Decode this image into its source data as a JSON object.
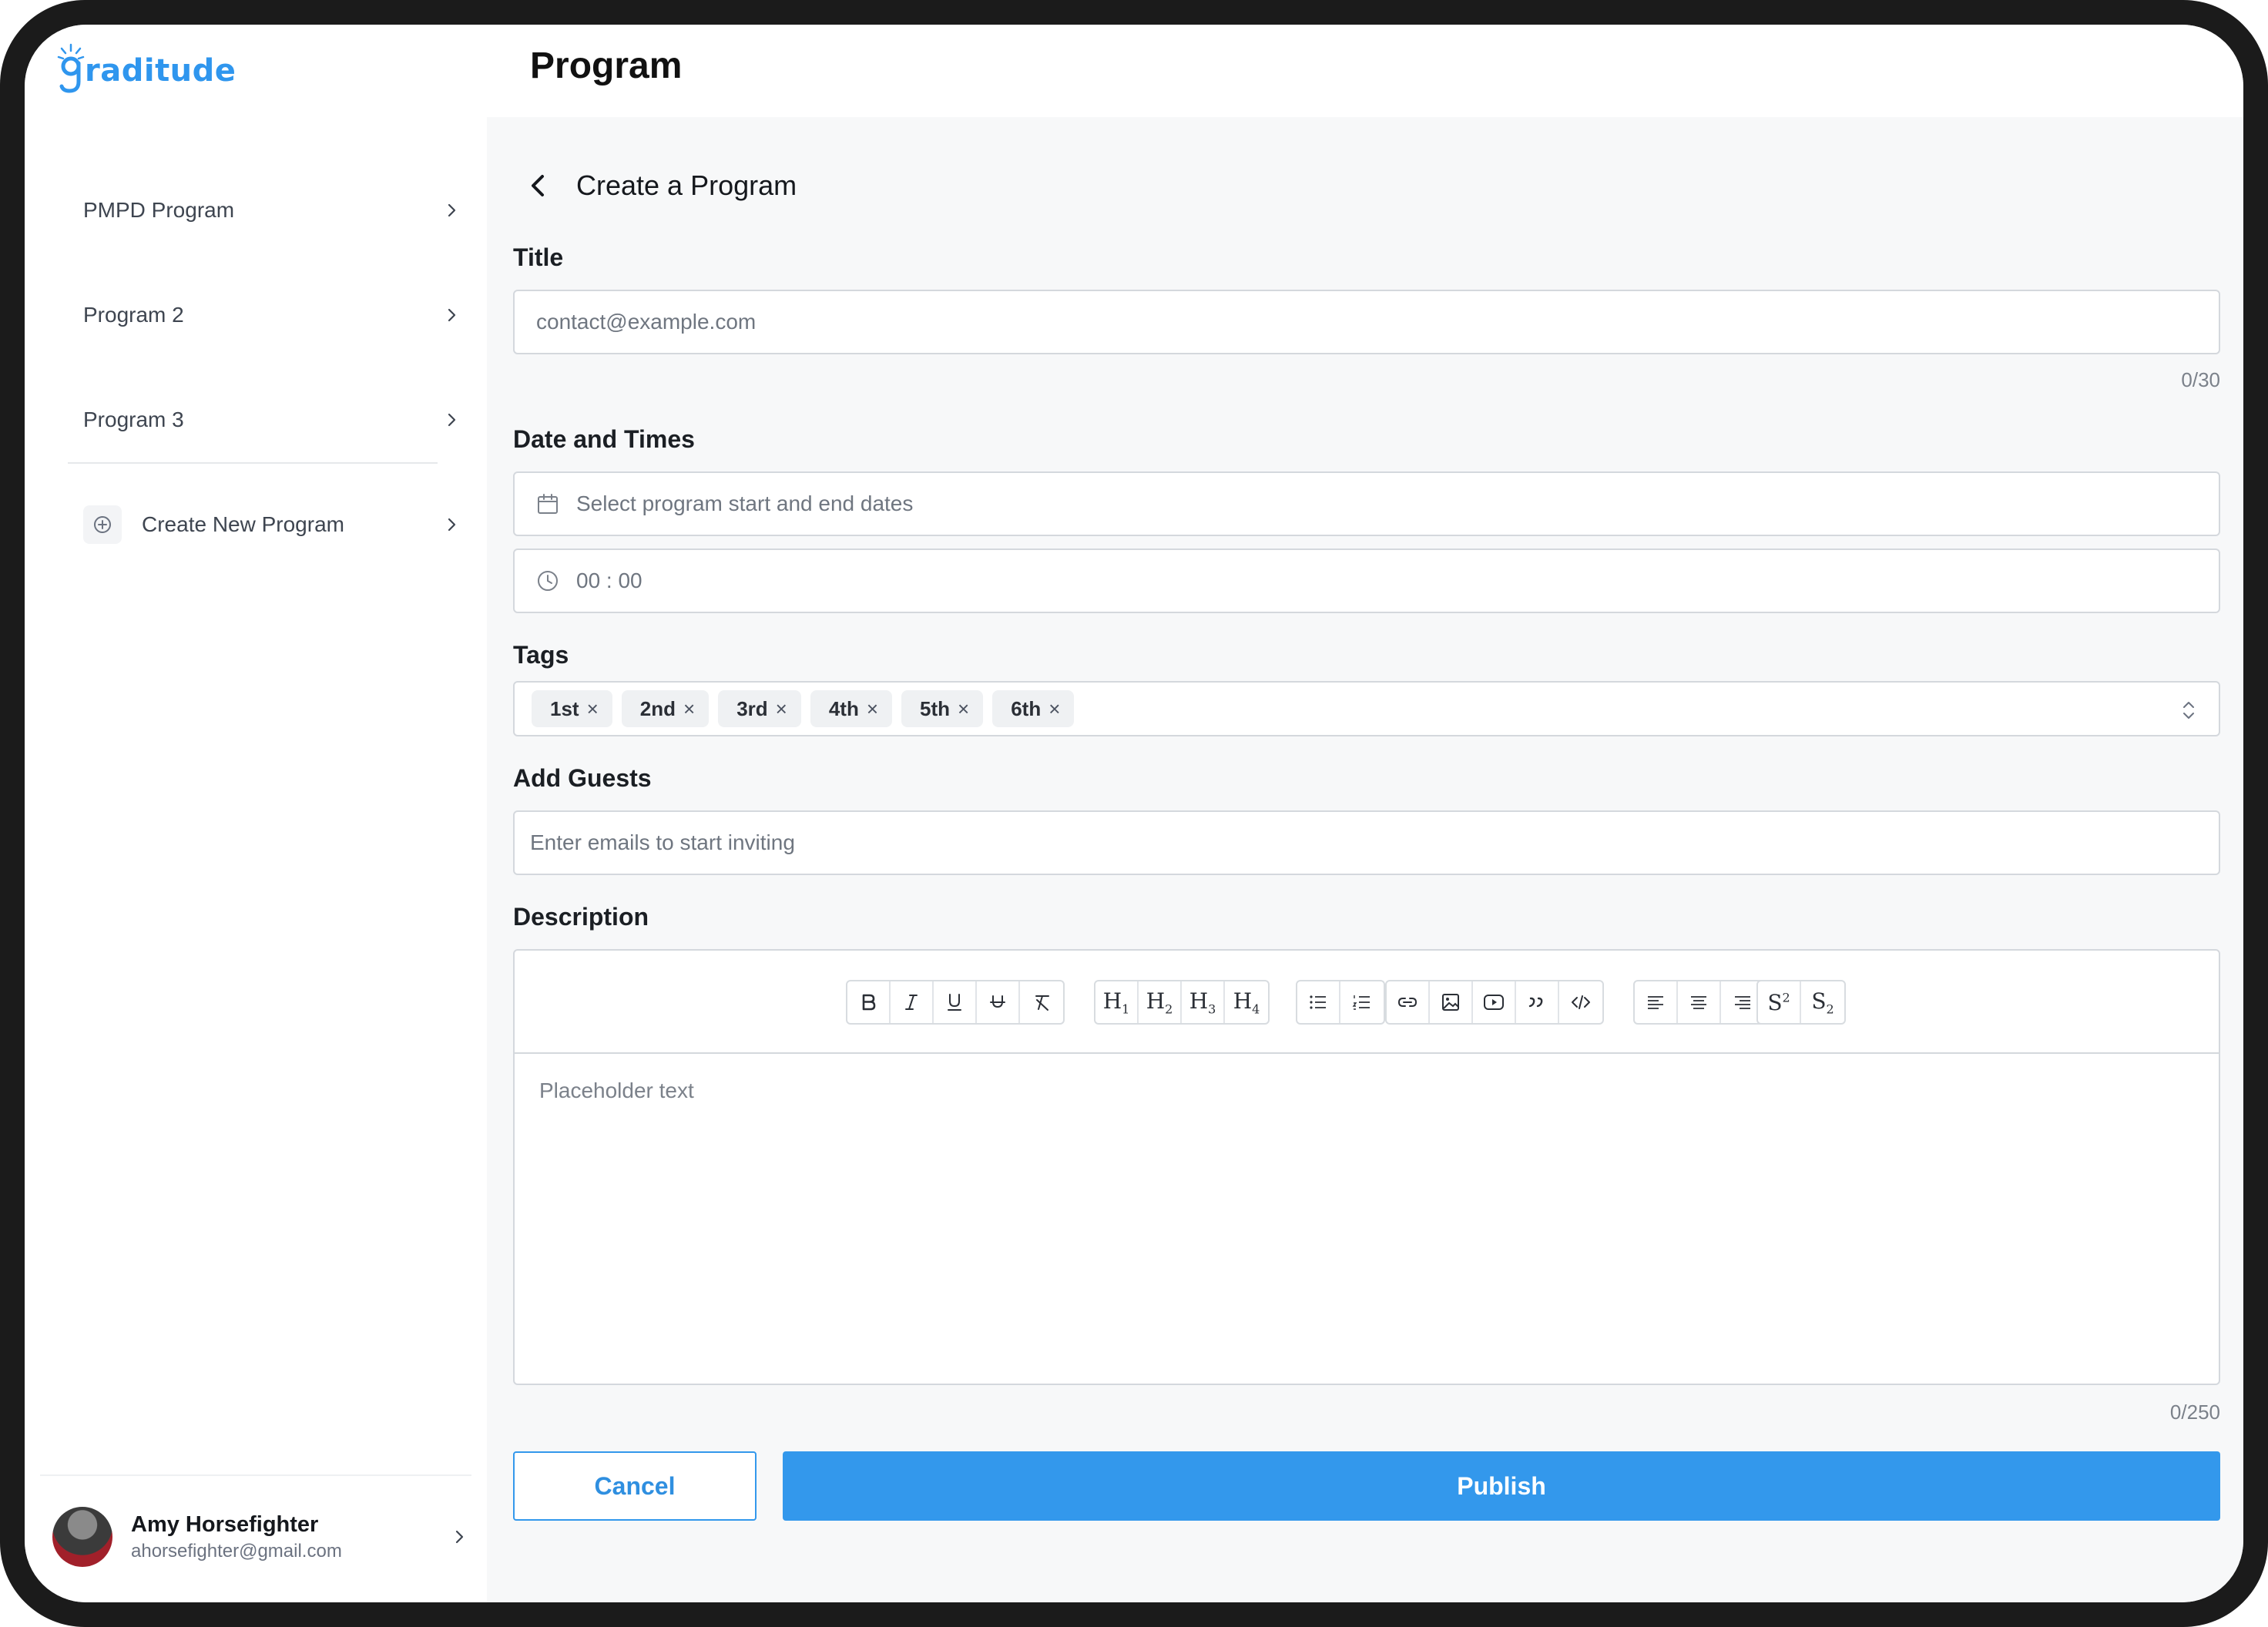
{
  "app": {
    "logo_text": "raditude",
    "brand_color": "#2f96ee"
  },
  "sidebar": {
    "items": [
      {
        "label": "PMPD Program",
        "icon": "chevron-right-icon"
      },
      {
        "label": "Program 2",
        "icon": "chevron-right-icon"
      },
      {
        "label": "Program 3",
        "icon": "chevron-right-icon"
      }
    ],
    "create_new": {
      "label": "Create New Program",
      "icon": "plus-circle-icon"
    },
    "user": {
      "name": "Amy Horsefighter",
      "email": "ahorsefighter@gmail.com"
    }
  },
  "header": {
    "title": "Program"
  },
  "form": {
    "section_title": "Create a Program",
    "title_label": "Title",
    "title_placeholder": "contact@example.com",
    "title_counter": "0/30",
    "date_label": "Date and Times",
    "date_placeholder": "Select program start and end dates",
    "time_value": "00 : 00",
    "tags_label": "Tags",
    "tags": [
      "1st",
      "2nd",
      "3rd",
      "4th",
      "5th",
      "6th"
    ],
    "tag_remove_glyph": "×",
    "guests_label": "Add Guests",
    "guests_placeholder": "Enter emails to start inviting",
    "description_label": "Description",
    "description_placeholder": "Placeholder text",
    "description_counter": "0/250",
    "cancel_label": "Cancel",
    "publish_label": "Publish"
  },
  "colors": {
    "accent": "#3398ec",
    "content_bg": "#f7f8f9"
  }
}
